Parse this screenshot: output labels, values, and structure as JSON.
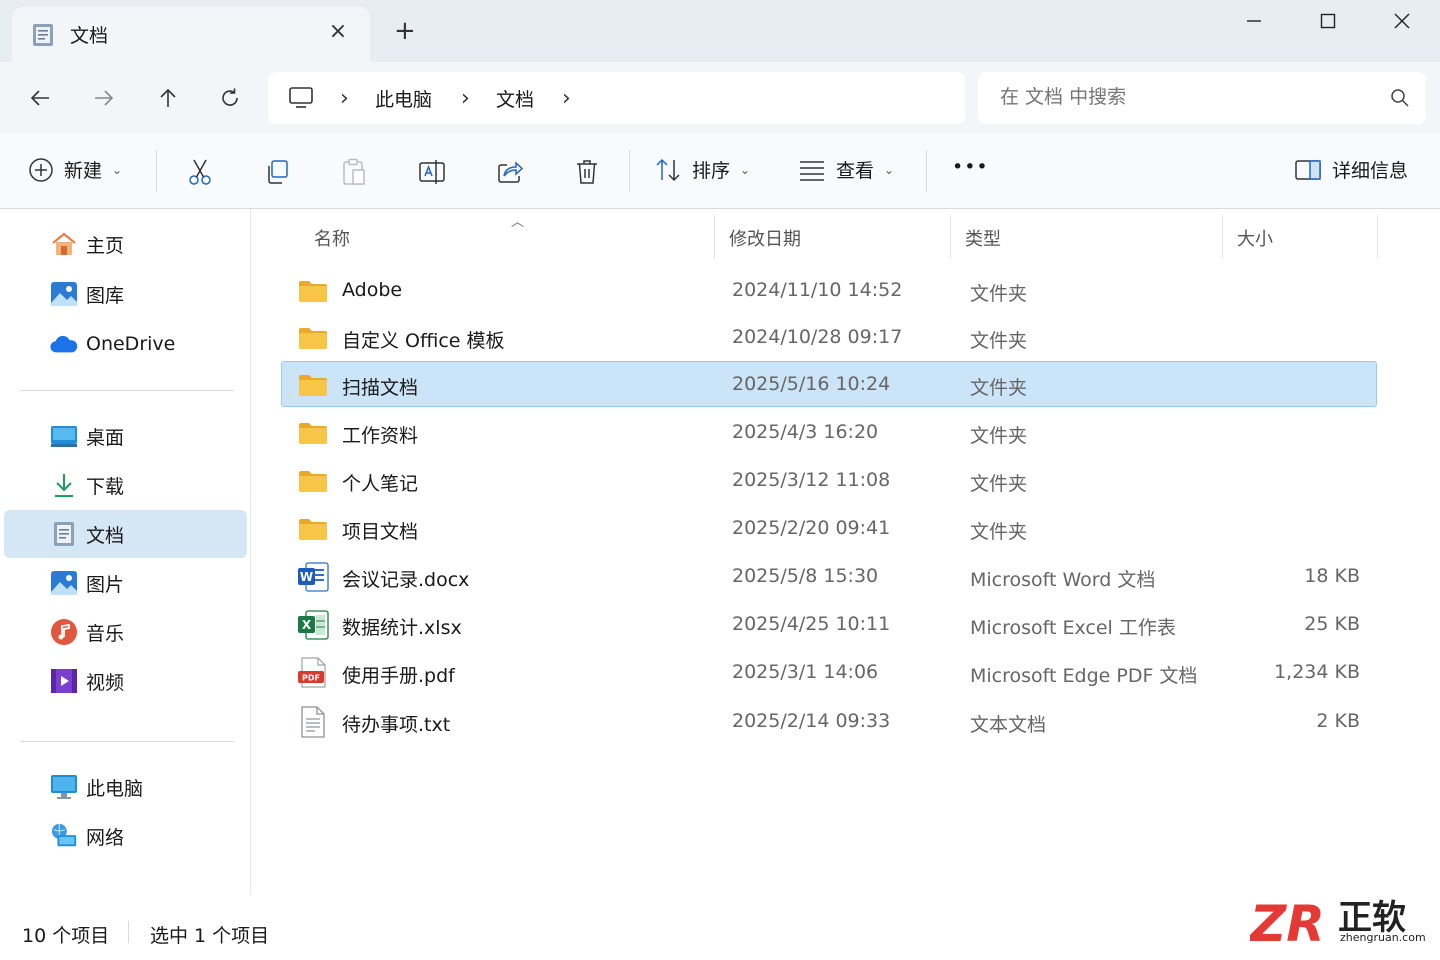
{
  "window": {
    "tab_title": "文档",
    "tab_close": "×",
    "new_tab": "+"
  },
  "nav": {
    "breadcrumb": [
      "此电脑",
      "文档"
    ],
    "separator": "›",
    "search_placeholder": "在 文档 中搜索"
  },
  "commands": {
    "new_label": "新建",
    "sort_label": "排序",
    "view_label": "查看",
    "more_label": "•••",
    "details_label": "详细信息",
    "dropdown_chevron": "⌄"
  },
  "sidebar": {
    "pinned": [
      {
        "label": "主页",
        "icon": "home-icon"
      },
      {
        "label": "图库",
        "icon": "gallery-icon"
      },
      {
        "label": "OneDrive",
        "icon": "onedrive-icon"
      }
    ],
    "folders": [
      {
        "label": "桌面",
        "icon": "desktop-icon"
      },
      {
        "label": "下载",
        "icon": "download-icon"
      },
      {
        "label": "文档",
        "icon": "documents-icon",
        "active": true
      },
      {
        "label": "图片",
        "icon": "pictures-icon"
      },
      {
        "label": "音乐",
        "icon": "music-icon"
      },
      {
        "label": "视频",
        "icon": "videos-icon"
      }
    ],
    "devices": [
      {
        "label": "此电脑",
        "icon": "this-pc-icon"
      },
      {
        "label": "网络",
        "icon": "network-icon"
      }
    ]
  },
  "columns": {
    "name": "名称",
    "modified": "修改日期",
    "type": "类型",
    "size": "大小",
    "sort_indicator": "︿"
  },
  "files": [
    {
      "name": "Adobe",
      "date": "2024/11/10 14:52",
      "type": "文件夹",
      "size": "",
      "icon": "folder-icon"
    },
    {
      "name": "自定义 Office 模板",
      "date": "2024/10/28 09:17",
      "type": "文件夹",
      "size": "",
      "icon": "folder-icon"
    },
    {
      "name": "扫描文档",
      "date": "2025/5/16 10:24",
      "type": "文件夹",
      "size": "",
      "icon": "folder-icon",
      "selected": true
    },
    {
      "name": "工作资料",
      "date": "2025/4/3 16:20",
      "type": "文件夹",
      "size": "",
      "icon": "folder-icon"
    },
    {
      "name": "个人笔记",
      "date": "2025/3/12 11:08",
      "type": "文件夹",
      "size": "",
      "icon": "folder-icon"
    },
    {
      "name": "项目文档",
      "date": "2025/2/20 09:41",
      "type": "文件夹",
      "size": "",
      "icon": "folder-icon"
    },
    {
      "name": "会议记录.docx",
      "date": "2025/5/8 15:30",
      "type": "Microsoft Word 文档",
      "size": "18 KB",
      "icon": "word-icon"
    },
    {
      "name": "数据统计.xlsx",
      "date": "2025/4/25 10:11",
      "type": "Microsoft Excel 工作表",
      "size": "25 KB",
      "icon": "excel-icon"
    },
    {
      "name": "使用手册.pdf",
      "date": "2025/3/1 14:06",
      "type": "Microsoft Edge PDF 文档",
      "size": "1,234 KB",
      "icon": "pdf-icon"
    },
    {
      "name": "待办事项.txt",
      "date": "2025/2/14 09:33",
      "type": "文本文档",
      "size": "2 KB",
      "icon": "text-file-icon"
    }
  ],
  "status": {
    "count": "10 个项目",
    "selected": "选中 1 个项目"
  },
  "watermark": {
    "logo": "ZR",
    "brand": "正软",
    "domain": "zhengruan.com"
  },
  "colors": {
    "accent": "#0067c0",
    "selection": "#cce4f7",
    "sidebar_active": "#d5e6f5",
    "folder": "#f8c646",
    "watermark_red": "#e53935"
  }
}
